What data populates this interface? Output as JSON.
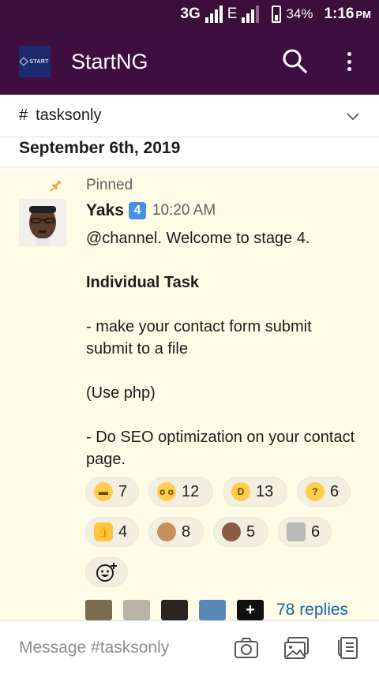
{
  "status_bar": {
    "network": "3G",
    "network2": "E",
    "battery": "34%",
    "time": "1:16",
    "ampm": "PM"
  },
  "app_bar": {
    "logo_text": "START",
    "title": "StartNG"
  },
  "channel": {
    "hash": "#",
    "name": "tasksonly"
  },
  "date_divider": "September 6th, 2019",
  "message": {
    "pinned_label": "Pinned",
    "sender": "Yaks",
    "badge": "4",
    "time": "10:20 AM",
    "lines": [
      "@channel. Welcome to stage 4.",
      "",
      "Individual Task",
      "",
      "- make your contact form submit submit to a file",
      "",
      "(Use php)",
      "",
      "- Do SEO optimization on your contact page."
    ],
    "reactions": [
      {
        "emoji": "grimacing-face",
        "count": "7"
      },
      {
        "emoji": "flushed-face",
        "count": "12"
      },
      {
        "emoji": "rolling-on-floor-laughing",
        "count": "13"
      },
      {
        "emoji": "thinking-face",
        "count": "6"
      },
      {
        "emoji": "thumbs-up",
        "count": "4"
      },
      {
        "emoji": "person-gesturing-ok",
        "count": "8"
      },
      {
        "emoji": "person-facepalming",
        "count": "5"
      },
      {
        "emoji": "technologist",
        "count": "6"
      }
    ],
    "replies_label": "78 replies"
  },
  "composer": {
    "placeholder": "Message #tasksonly"
  },
  "colors": {
    "status_bar_bg": "#3b0e3c",
    "app_bar_bg": "#3f0e40",
    "message_highlight": "#fefbe6",
    "link": "#1264a3"
  }
}
